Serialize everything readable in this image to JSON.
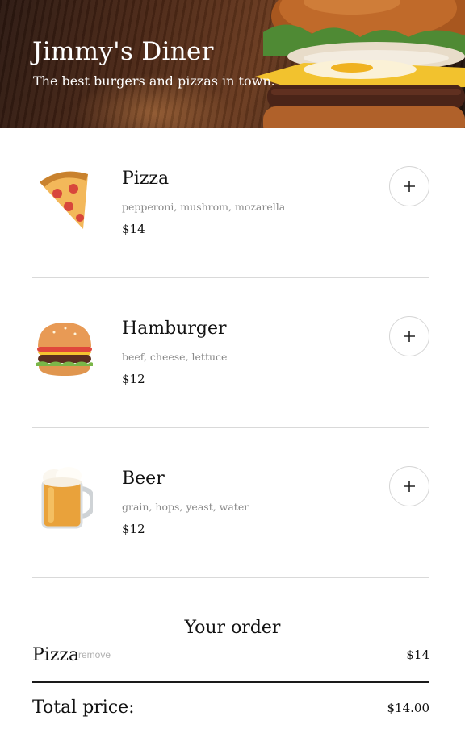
{
  "header": {
    "title": "Jimmy's Diner",
    "subtitle": "The best burgers and pizzas in town."
  },
  "menu": {
    "items": [
      {
        "name": "Pizza",
        "ingredients": "pepperoni, mushrom, mozarella",
        "price": "$14",
        "icon": "pizza-icon"
      },
      {
        "name": "Hamburger",
        "ingredients": "beef, cheese, lettuce",
        "price": "$12",
        "icon": "hamburger-icon"
      },
      {
        "name": "Beer",
        "ingredients": "grain, hops, yeast, water",
        "price": "$12",
        "icon": "beer-mug-icon"
      }
    ],
    "add_icon": "plus-icon"
  },
  "order": {
    "title": "Your order",
    "items": [
      {
        "name": "Pizza",
        "remove_label": "remove",
        "price": "$14"
      }
    ],
    "total_label": "Total price:",
    "total_value": "$14.00"
  }
}
